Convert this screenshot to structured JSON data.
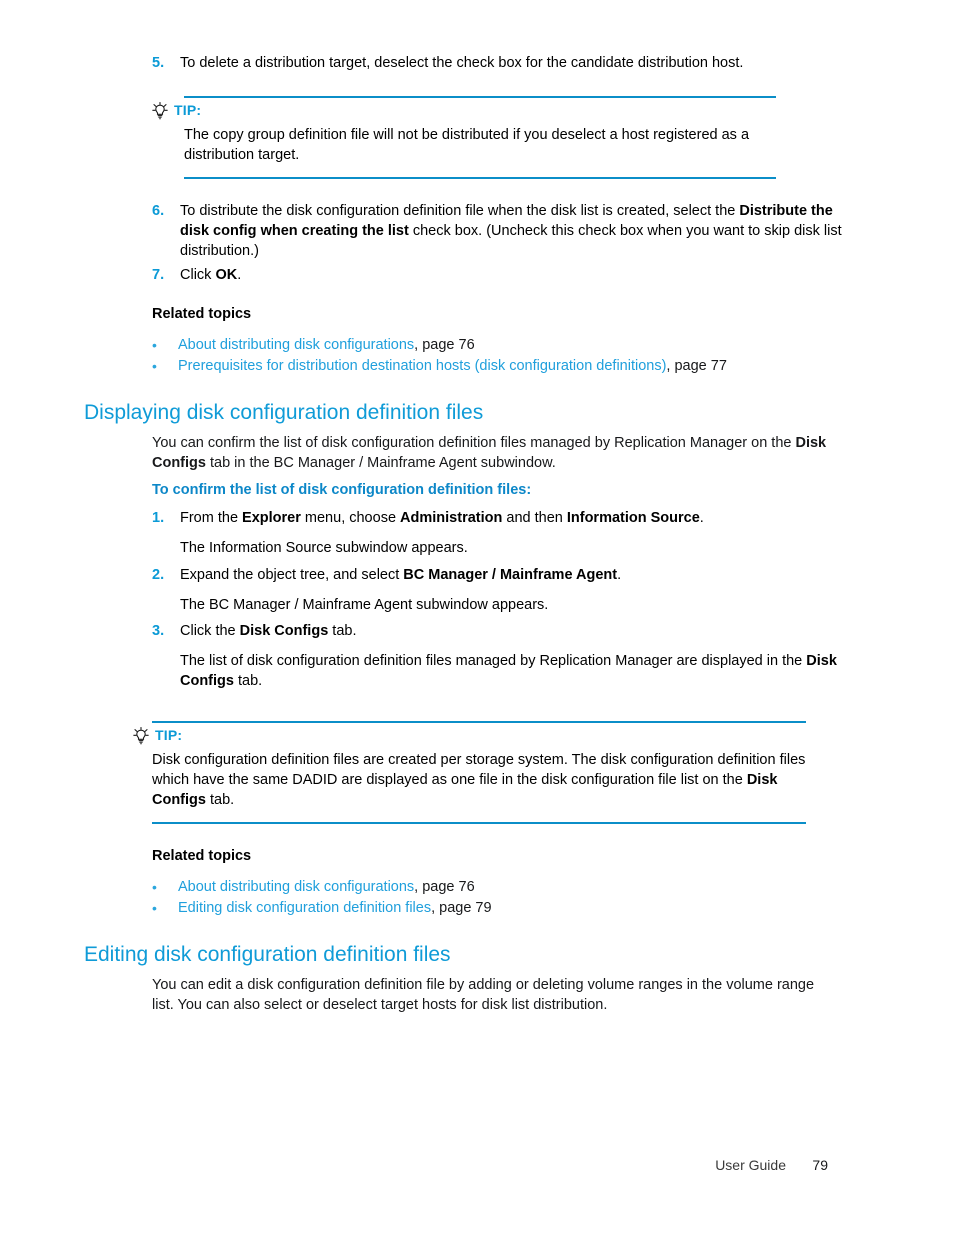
{
  "page": {
    "footer_label": "User Guide",
    "footer_page_number": "79"
  },
  "colors": {
    "heading_blue": "#0f9bd7",
    "subheading_blue": "#0c87c8",
    "link_blue": "#1f9fdc",
    "step_number_blue": "#0b9ad6",
    "rule_blue": "#0b8ec8",
    "body_black": "#17181a"
  },
  "steps_top": [
    {
      "number": "5.",
      "text": "To delete a distribution target, deselect the check box for the candidate distribution host."
    }
  ],
  "tip_one": {
    "icon": "lightbulb-icon",
    "label": "TIP:",
    "text": "The copy group definition file will not be distributed if you deselect a host registered as a distribution target."
  },
  "steps_mid": [
    {
      "number": "6.",
      "parts": [
        {
          "text": "To distribute the disk configuration definition file when the disk list is created, select the ",
          "bold": false
        },
        {
          "text": "Distribute the disk config when creating the list",
          "bold": true
        },
        {
          "text": " check box. (Uncheck this check box when you want to skip disk list distribution.)",
          "bold": false
        }
      ]
    },
    {
      "number": "7.",
      "parts": [
        {
          "text": "Click ",
          "bold": false
        },
        {
          "text": "OK",
          "bold": true
        },
        {
          "text": ".",
          "bold": false
        }
      ]
    }
  ],
  "related_topics_one": {
    "heading": "Related topics",
    "items": [
      {
        "bullet": "•",
        "link": "About distributing disk configurations",
        "page": ", page 76"
      },
      {
        "bullet": "•",
        "link": "Prerequisites for distribution destination hosts (disk configuration definitions)",
        "page": ", page 77"
      }
    ]
  },
  "section_displaying": {
    "heading": "Displaying disk configuration definition files",
    "intro_parts": [
      {
        "text": "You can confirm the list of disk configuration definition files managed by Replication Manager on the ",
        "bold": false
      },
      {
        "text": "Disk Configs",
        "bold": true
      },
      {
        "text": " tab in the BC Manager / Mainframe Agent subwindow.",
        "bold": false
      }
    ],
    "subheading": "To confirm the list of disk configuration definition files:",
    "steps": [
      {
        "number": "1.",
        "parts": [
          {
            "text": "From the ",
            "bold": false
          },
          {
            "text": "Explorer",
            "bold": true
          },
          {
            "text": " menu, choose ",
            "bold": false
          },
          {
            "text": "Administration",
            "bold": true
          },
          {
            "text": " and then ",
            "bold": false
          },
          {
            "text": "Information Source",
            "bold": true
          },
          {
            "text": ".",
            "bold": false
          }
        ],
        "result": "The Information Source subwindow appears."
      },
      {
        "number": "2.",
        "parts": [
          {
            "text": "Expand the object tree, and select ",
            "bold": false
          },
          {
            "text": "BC Manager / Mainframe Agent",
            "bold": true
          },
          {
            "text": ".",
            "bold": false
          }
        ],
        "result": "The BC Manager / Mainframe Agent subwindow appears."
      },
      {
        "number": "3.",
        "parts": [
          {
            "text": "Click the ",
            "bold": false
          },
          {
            "text": "Disk Configs",
            "bold": true
          },
          {
            "text": " tab.",
            "bold": false
          }
        ],
        "result_parts": [
          {
            "text": "The list of disk configuration definition files managed by Replication Manager are displayed in the ",
            "bold": false
          },
          {
            "text": "Disk Configs",
            "bold": true
          },
          {
            "text": " tab.",
            "bold": false
          }
        ]
      }
    ]
  },
  "tip_two": {
    "icon": "lightbulb-icon",
    "label": "TIP:",
    "parts": [
      {
        "text": "Disk configuration definition files are created per storage system. The disk configuration definition files which have the same DADID are displayed as one file in the disk configuration file list on the ",
        "bold": false
      },
      {
        "text": "Disk Configs",
        "bold": true
      },
      {
        "text": " tab.",
        "bold": false
      }
    ]
  },
  "related_topics_two": {
    "heading": "Related topics",
    "items": [
      {
        "bullet": "•",
        "link": "About distributing disk configurations",
        "page": ", page 76"
      },
      {
        "bullet": "•",
        "link": "Editing disk configuration definition files",
        "page": ", page 79"
      }
    ]
  },
  "section_editing": {
    "heading": "Editing disk configuration definition files",
    "intro": "You can edit a disk configuration definition file by adding or deleting volume ranges in the volume range list. You can also select or deselect target hosts for disk list distribution."
  }
}
